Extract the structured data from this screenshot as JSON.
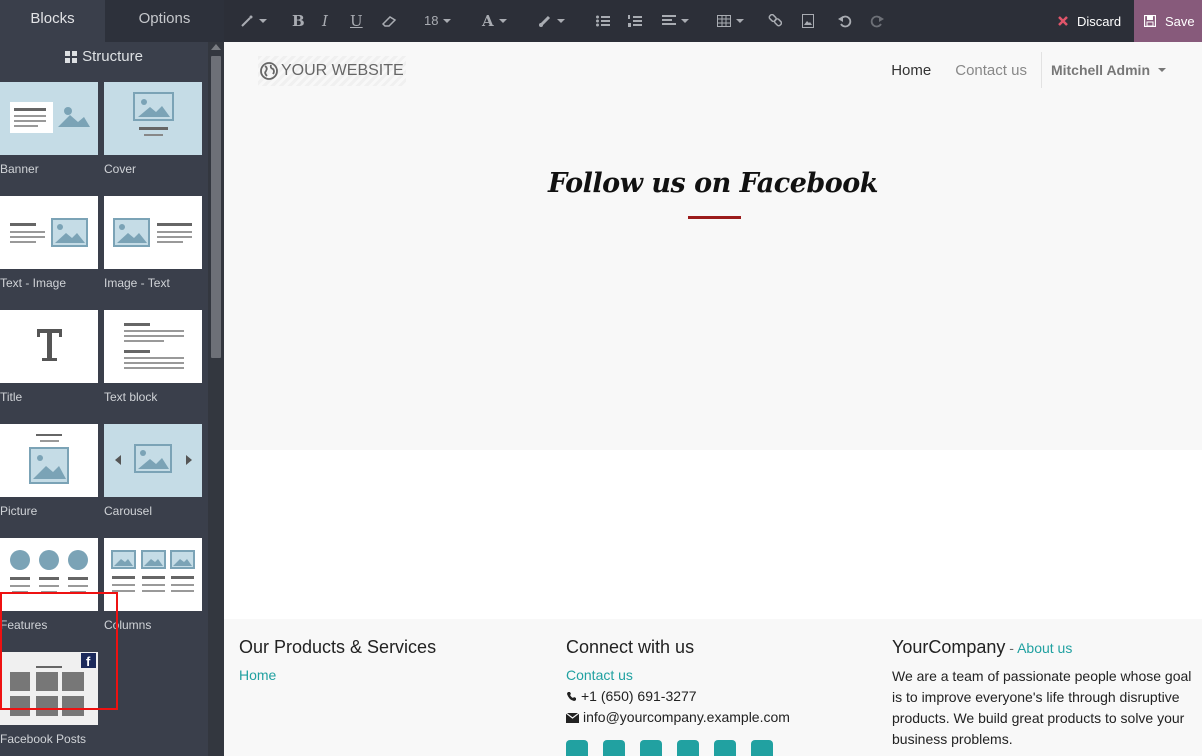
{
  "sidebar": {
    "tabs": {
      "blocks": "Blocks",
      "options": "Options"
    },
    "section_title": "Structure",
    "blocks": [
      {
        "label": "Banner"
      },
      {
        "label": "Cover"
      },
      {
        "label": "Text - Image"
      },
      {
        "label": "Image - Text"
      },
      {
        "label": "Title"
      },
      {
        "label": "Text block"
      },
      {
        "label": "Picture"
      },
      {
        "label": "Carousel"
      },
      {
        "label": "Features"
      },
      {
        "label": "Columns"
      },
      {
        "label": "Facebook Posts"
      }
    ]
  },
  "toolbar": {
    "font_size": "18",
    "discard_label": "Discard",
    "save_label": "Save",
    "icons": [
      "magic-wand-icon",
      "bold-icon",
      "italic-icon",
      "underline-icon",
      "eraser-icon",
      "font-color-icon",
      "paint-brush-icon",
      "unordered-list-icon",
      "ordered-list-icon",
      "align-icon",
      "table-icon",
      "link-icon",
      "image-icon",
      "undo-icon",
      "redo-icon"
    ]
  },
  "site": {
    "logo_text": "YOUR WEBSITE",
    "nav": {
      "home": "Home",
      "contact": "Contact us",
      "user": "Mitchell Admin"
    },
    "hero_title": "Follow us on Facebook"
  },
  "footer": {
    "col1": {
      "title": "Our Products & Services",
      "link": "Home"
    },
    "col2": {
      "title": "Connect with us",
      "contact_link": "Contact us",
      "phone": "+1 (650) 691-3277",
      "email": "info@yourcompany.example.com"
    },
    "col3": {
      "company": "YourCompany",
      "dash": " - ",
      "about_link": "About us",
      "text": "We are a team of passionate people whose goal is to improve everyone's life through disruptive products. We build great products to solve your business problems."
    }
  },
  "colors": {
    "accent": "#21a1a1",
    "save_bg": "#875a7b",
    "underline": "#9b1b1b"
  }
}
